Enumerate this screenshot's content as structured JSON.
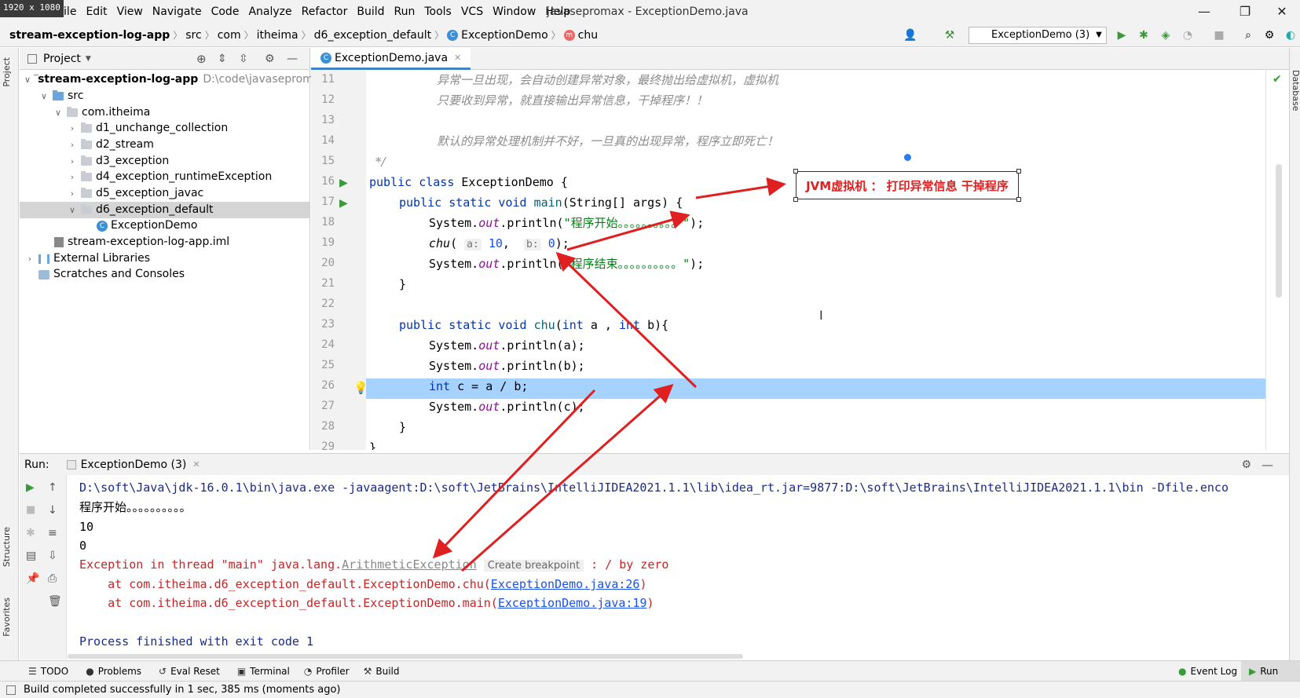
{
  "resolution_badge": "1920 x 1080",
  "menu": [
    "File",
    "Edit",
    "View",
    "Navigate",
    "Code",
    "Analyze",
    "Refactor",
    "Build",
    "Run",
    "Tools",
    "VCS",
    "Window",
    "Help"
  ],
  "window_title": "javasepromax - ExceptionDemo.java",
  "breadcrumb": {
    "project": "stream-exception-log-app",
    "src": "src",
    "com": "com",
    "itheima": "itheima",
    "pkg": "d6_exception_default",
    "cls": "ExceptionDemo",
    "method": "chu"
  },
  "run_config": "ExceptionDemo (3)",
  "project_panel": {
    "title": "Project",
    "root": "stream-exception-log-app",
    "root_path": "D:\\code\\javasepromax",
    "items": [
      "src",
      "com.itheima",
      "d1_unchange_collection",
      "d2_stream",
      "d3_exception",
      "d4_exception_runtimeException",
      "d5_exception_javac",
      "d6_exception_default",
      "ExceptionDemo",
      "stream-exception-log-app.iml",
      "External Libraries",
      "Scratches and Consoles"
    ]
  },
  "editor": {
    "tab": "ExceptionDemo.java",
    "line_numbers": [
      "11",
      "12",
      "13",
      "14",
      "15",
      "16",
      "17",
      "18",
      "19",
      "20",
      "21",
      "22",
      "23",
      "24",
      "25",
      "26",
      "27",
      "28",
      "29"
    ],
    "comment_11": "异常一旦出现，会自动创建异常对象，最终抛出给虚拟机，虚拟机",
    "comment_12": "只要收到异常，就直接输出异常信息，干掉程序！！",
    "comment_14": "默认的异常处理机制并不好，一旦真的出现异常，程序立即死亡！",
    "comment_end": "*/",
    "str_start": "\"程序开始。。。。。。。。。。\"",
    "str_end": "\"程序结束。。。。。。。。。。\"",
    "hint_a": "a:",
    "hint_b": "b:"
  },
  "annotation": "JVM虚拟机 ： 打印异常信息  干掉程序",
  "run_panel": {
    "label": "Run:",
    "tab": "ExceptionDemo (3)",
    "cmd": "D:\\soft\\Java\\jdk-16.0.1\\bin\\java.exe -javaagent:D:\\soft\\JetBrains\\IntelliJIDEA2021.1.1\\lib\\idea_rt.jar=9877:D:\\soft\\JetBrains\\IntelliJIDEA2021.1.1\\bin -Dfile.enco",
    "out1": "程序开始。。。。。。。。。。",
    "out2": "10",
    "out3": "0",
    "exc_prefix": "Exception in thread \"main\" java.lang.",
    "exc_class": "ArithmeticException",
    "create_bp": "Create breakpoint",
    "exc_msg": " : / by zero",
    "at1_prefix": "    at com.itheima.d6_exception_default.ExceptionDemo.chu(",
    "at1_link": "ExceptionDemo.java:26",
    "at2_prefix": "    at com.itheima.d6_exception_default.ExceptionDemo.main(",
    "at2_link": "ExceptionDemo.java:19",
    "close_paren": ")",
    "finished": "Process finished with exit code 1"
  },
  "bottom_tools": [
    "TODO",
    "Problems",
    "Eval Reset",
    "Terminal",
    "Profiler",
    "Build"
  ],
  "event_log": "Event Log",
  "run_tool": "Run",
  "status": "Build completed successfully in 1 sec, 385 ms (moments ago)",
  "side_tabs": {
    "project": "Project",
    "structure": "Structure",
    "favorites": "Favorites",
    "database": "Database"
  },
  "colors": {
    "accent": "#4083c9",
    "highlight": "#a6d2ff",
    "error": "#c42525",
    "annotation": "#e02020"
  }
}
